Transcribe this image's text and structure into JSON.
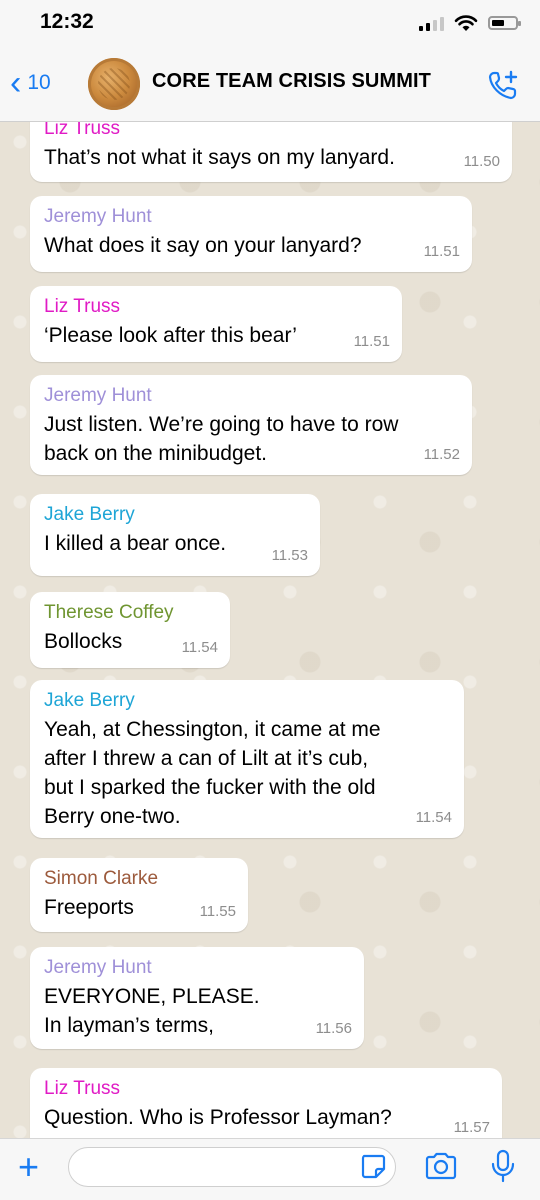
{
  "status": {
    "time": "12:32"
  },
  "header": {
    "back_count": "10",
    "title": "CORE TEAM CRISIS SUMMIT"
  },
  "colors": {
    "liz_truss": "#e01bc5",
    "jeremy_hunt": "#9f90d8",
    "jake_berry": "#1ea5d6",
    "therese_coffey": "#6f9531",
    "simon_clarke": "#9c5a3c",
    "accent": "#1a7cf2"
  },
  "messages": [
    {
      "sender": "Liz Truss",
      "lines": [
        "That’s not what it says on my lanyard."
      ],
      "time": "11.50"
    },
    {
      "sender": "Jeremy Hunt",
      "lines": [
        "What does it say on your lanyard?"
      ],
      "time": "11.51"
    },
    {
      "sender": "Liz Truss",
      "lines": [
        "‘Please look after this bear’"
      ],
      "time": "11.51"
    },
    {
      "sender": "Jeremy Hunt",
      "lines": [
        "Just listen. We’re going to have to row",
        "back on the minibudget."
      ],
      "time": "11.52"
    },
    {
      "sender": "Jake Berry",
      "lines": [
        "I killed a bear once."
      ],
      "time": "11.53"
    },
    {
      "sender": "Therese Coffey",
      "lines": [
        "Bollocks"
      ],
      "time": "11.54"
    },
    {
      "sender": "Jake Berry",
      "lines": [
        "Yeah, at Chessington, it came at me",
        "after I threw a can of Lilt at it’s cub,",
        "but I sparked the fucker with the old",
        "Berry one-two."
      ],
      "time": "11.54"
    },
    {
      "sender": "Simon Clarke",
      "lines": [
        "Freeports"
      ],
      "time": "11.55"
    },
    {
      "sender": "Jeremy Hunt",
      "lines": [
        "EVERYONE, PLEASE.",
        "In layman’s terms,"
      ],
      "time": "11.56"
    },
    {
      "sender": "Liz Truss",
      "lines": [
        "Question. Who is Professor Layman?"
      ],
      "time": "11.57"
    }
  ],
  "icons": [
    "back-chevron-icon",
    "group-avatar-icon",
    "add-call-icon",
    "plus-icon",
    "sticker-icon",
    "camera-icon",
    "microphone-icon"
  ]
}
